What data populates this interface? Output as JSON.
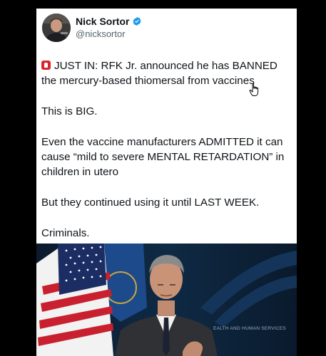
{
  "author": {
    "name": "Nick Sortor",
    "handle": "@nicksortor",
    "verified": true
  },
  "post": {
    "lines": [
      "JUST IN: RFK Jr. announced he has BANNED",
      "the mercury-based thiomersal from vaccines",
      "This is BIG.",
      "Even the vaccine manufacturers ADMITTED it can",
      "cause “mild to severe MENTAL RETARDATION” in",
      "children in utero",
      "But they continued using it until LAST WEEK.",
      "Criminals."
    ]
  },
  "media": {
    "backdrop_text": "EALTH AND HUMAN SERVICES"
  },
  "colors": {
    "verified_badge": "#1d9bf0",
    "siren_emoji": "#d9262c",
    "backdrop": "#0e2036"
  },
  "icons": [
    "verified-badge-icon",
    "siren-emoji-icon",
    "hand-pointer-cursor-icon"
  ]
}
